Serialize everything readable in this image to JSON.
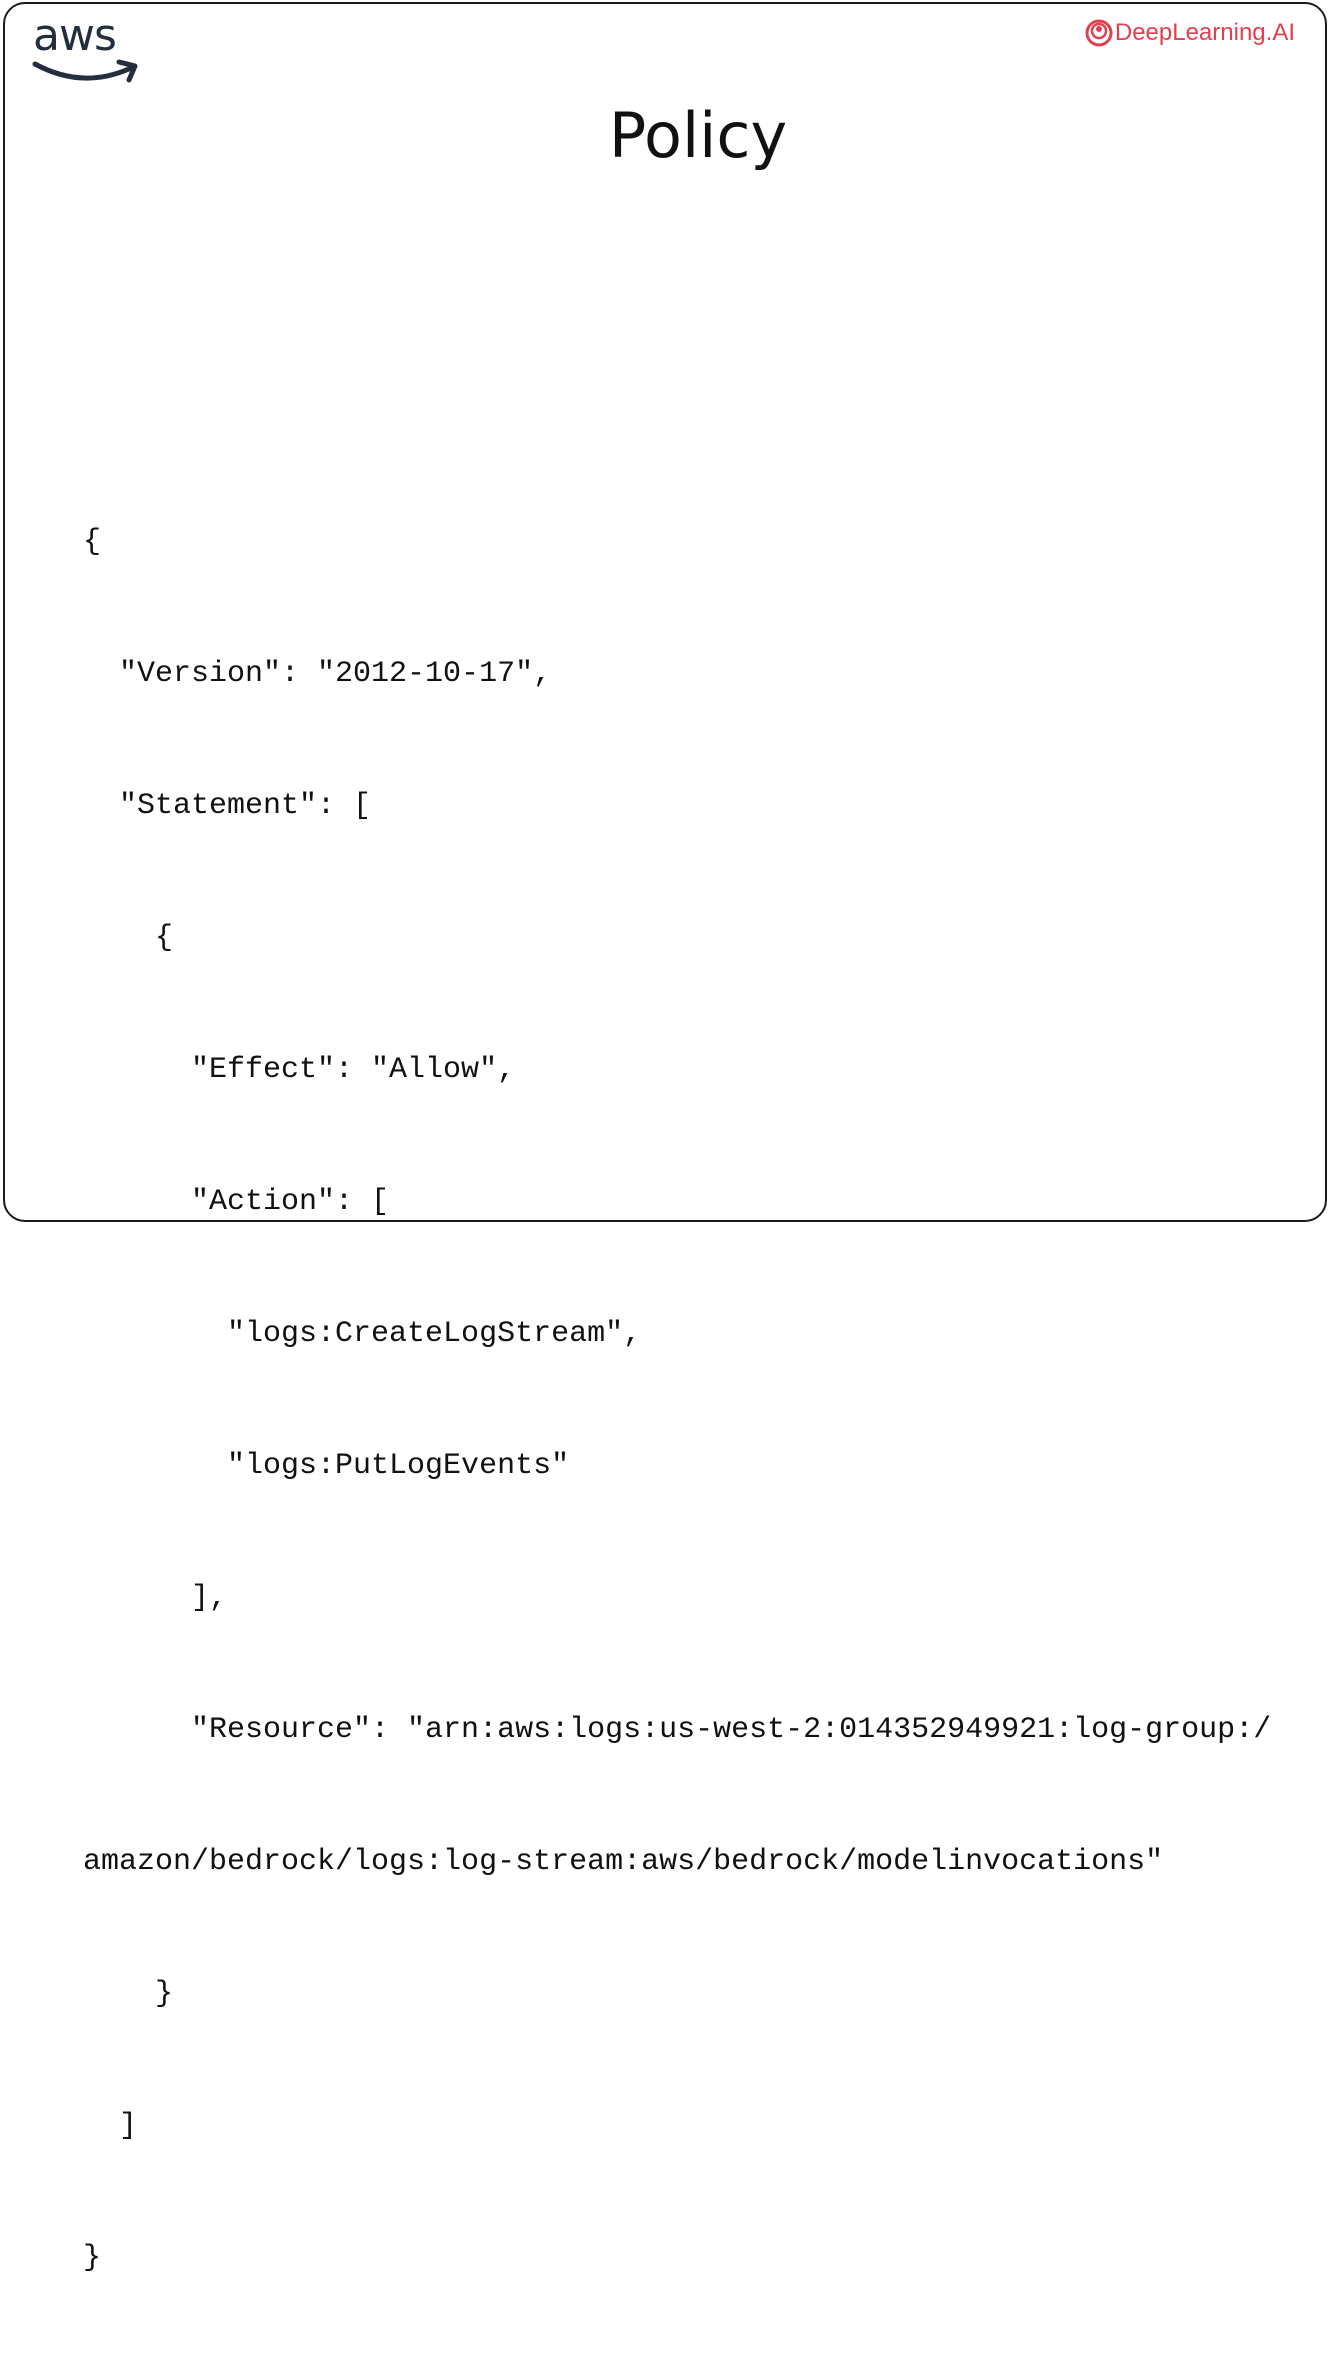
{
  "header": {
    "aws_logo_text": "aws",
    "brand_text": "DeepLearning.AI"
  },
  "slide": {
    "title": "Policy"
  },
  "code": {
    "lines": [
      "{",
      "  \"Version\": \"2012-10-17\",",
      "  \"Statement\": [",
      "    {",
      "      \"Effect\": \"Allow\",",
      "      \"Action\": [",
      "        \"logs:CreateLogStream\",",
      "        \"logs:PutLogEvents\"",
      "      ],",
      "      \"Resource\": \"arn:aws:logs:us-west-2:014352949921:log-group:/",
      "amazon/bedrock/logs:log-stream:aws/bedrock/modelinvocations\"",
      "    }",
      "  ]",
      "}"
    ]
  },
  "colors": {
    "brand_red": "#e0404f",
    "aws_dark": "#232f3e",
    "text": "#111111"
  }
}
